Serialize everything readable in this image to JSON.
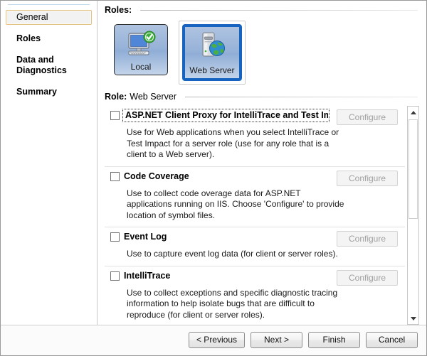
{
  "sidebar": {
    "items": [
      {
        "label": "General",
        "selected": true
      },
      {
        "label": "Roles",
        "selected": false
      },
      {
        "label": "Data and Diagnostics",
        "selected": false
      },
      {
        "label": "Summary",
        "selected": false
      }
    ]
  },
  "roles_section": {
    "header_label": "Roles:",
    "tiles": [
      {
        "label": "Local",
        "icon": "monitor-check-icon",
        "selected": false
      },
      {
        "label": "Web Server",
        "icon": "server-globe-icon",
        "selected": true
      }
    ]
  },
  "role_detail": {
    "header_label": "Role:",
    "header_value": "Web Server",
    "configure_label": "Configure",
    "items": [
      {
        "title": "ASP.NET Client Proxy for IntelliTrace and Test Impact",
        "description": "Use for Web applications when you select IntelliTrace or Test Impact for a server role (use for any role that is a client to a Web server).",
        "checked": false,
        "focused": true,
        "configure_enabled": false
      },
      {
        "title": "Code Coverage",
        "description": "Use to collect code overage data for ASP.NET applications running on IIS. Choose 'Configure' to provide location of symbol files.",
        "checked": false,
        "focused": false,
        "configure_enabled": false
      },
      {
        "title": "Event Log",
        "description": "Use to capture event log data (for client or server roles).",
        "checked": false,
        "focused": false,
        "configure_enabled": false
      },
      {
        "title": "IntelliTrace",
        "description": "Use to collect exceptions and specific diagnostic tracing information to help isolate bugs that are difficult to reproduce (for client or server roles).",
        "checked": false,
        "focused": false,
        "configure_enabled": false
      }
    ]
  },
  "scrollbar": {
    "up_icon": "scroll-up-arrow-icon",
    "down_icon": "scroll-down-arrow-icon"
  },
  "footer": {
    "buttons": [
      {
        "label": "< Previous"
      },
      {
        "label": "Next >"
      },
      {
        "label": "Finish"
      },
      {
        "label": "Cancel"
      }
    ]
  },
  "colors": {
    "selection_blue": "#1764c0",
    "nav_selected_border": "#e4c283",
    "tile_gradient_top": "#aec3e0",
    "disabled_text": "#a0a0a0"
  }
}
